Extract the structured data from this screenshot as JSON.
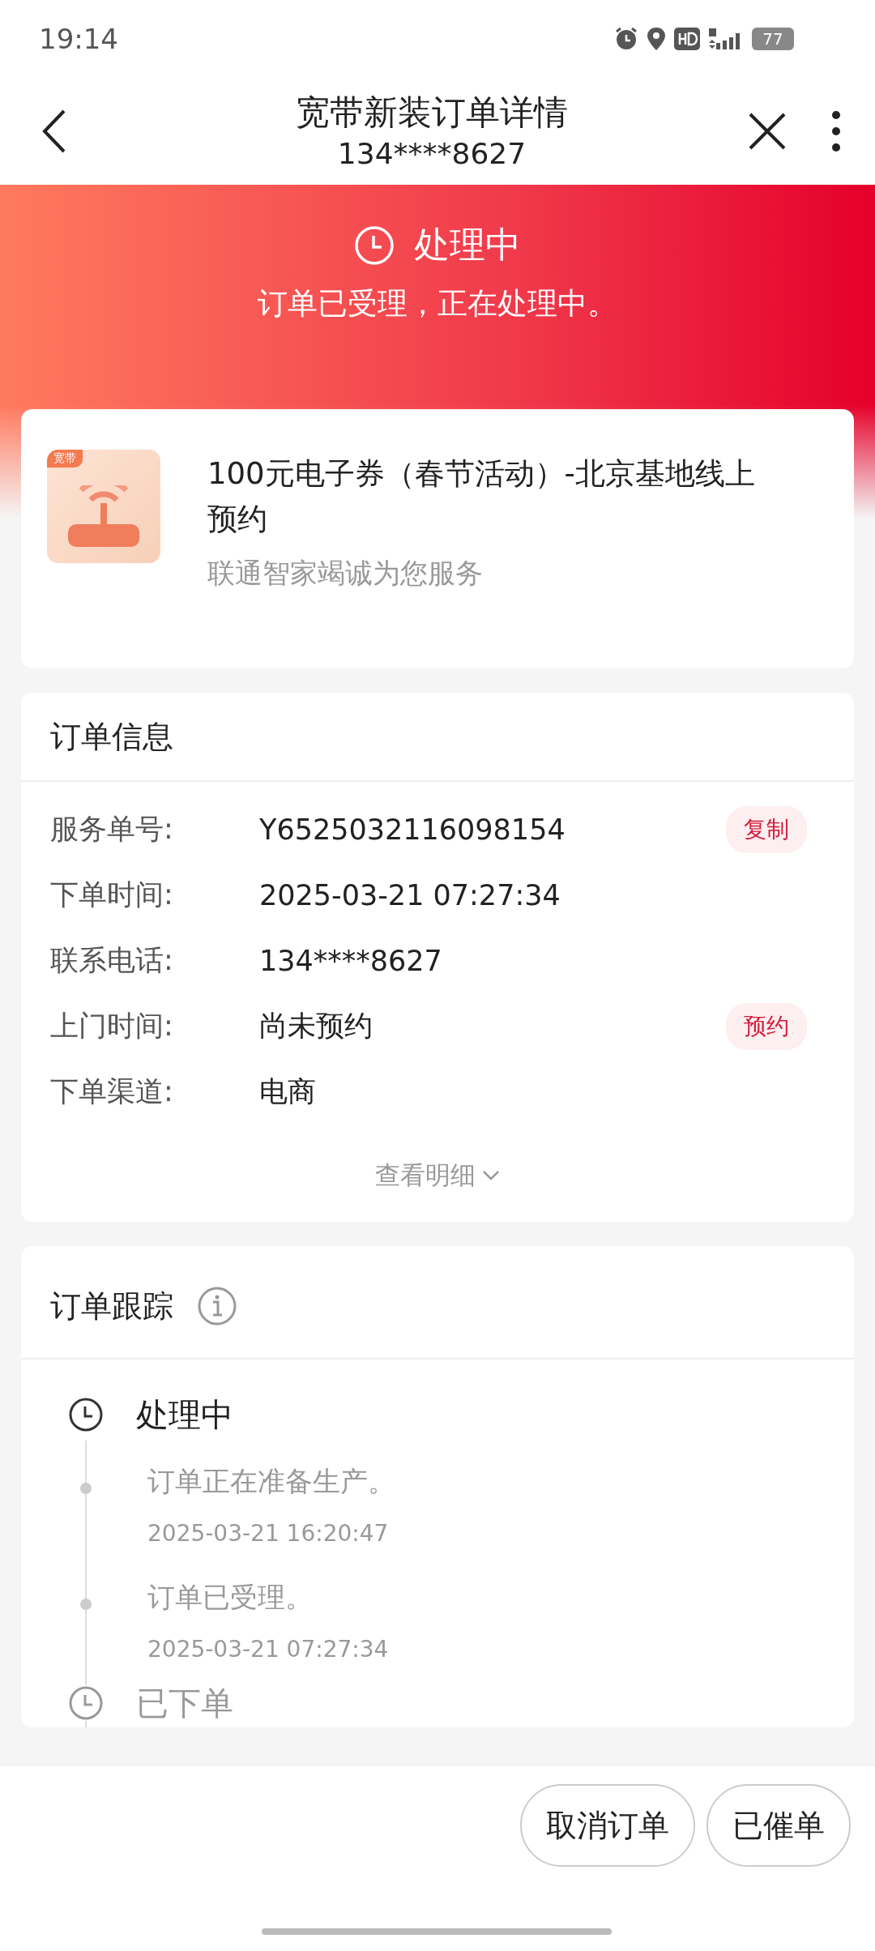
{
  "status_bar": {
    "time": "19:14",
    "battery": "77"
  },
  "header": {
    "title": "宽带新装订单详情",
    "subtitle": "134****8627"
  },
  "status_banner": {
    "title": "处理中",
    "message": "订单已受理，正在处理中。"
  },
  "product": {
    "badge": "宽带",
    "name": "100元电子券（春节活动）-北京基地线上预约",
    "subtitle": "联通智家竭诚为您服务"
  },
  "order_info": {
    "title": "订单信息",
    "rows": [
      {
        "label": "服务单号:",
        "value": "Y6525032116098154",
        "action": "复制"
      },
      {
        "label": "下单时间:",
        "value": "2025-03-21 07:27:34"
      },
      {
        "label": "联系电话:",
        "value": "134****8627"
      },
      {
        "label": "上门时间:",
        "value": "尚未预约",
        "action": "预约"
      },
      {
        "label": "下单渠道:",
        "value": "电商"
      }
    ],
    "details_link": "查看明细"
  },
  "tracking": {
    "title": "订单跟踪",
    "steps": [
      {
        "title": "处理中",
        "active": true,
        "children": [
          {
            "text": "订单正在准备生产。",
            "time": "2025-03-21 16:20:47"
          },
          {
            "text": "订单已受理。",
            "time": "2025-03-21 07:27:34"
          }
        ]
      },
      {
        "title": "已下单",
        "active": false
      }
    ]
  },
  "actions": [
    {
      "label": "取消订单"
    },
    {
      "label": "已催单"
    }
  ]
}
